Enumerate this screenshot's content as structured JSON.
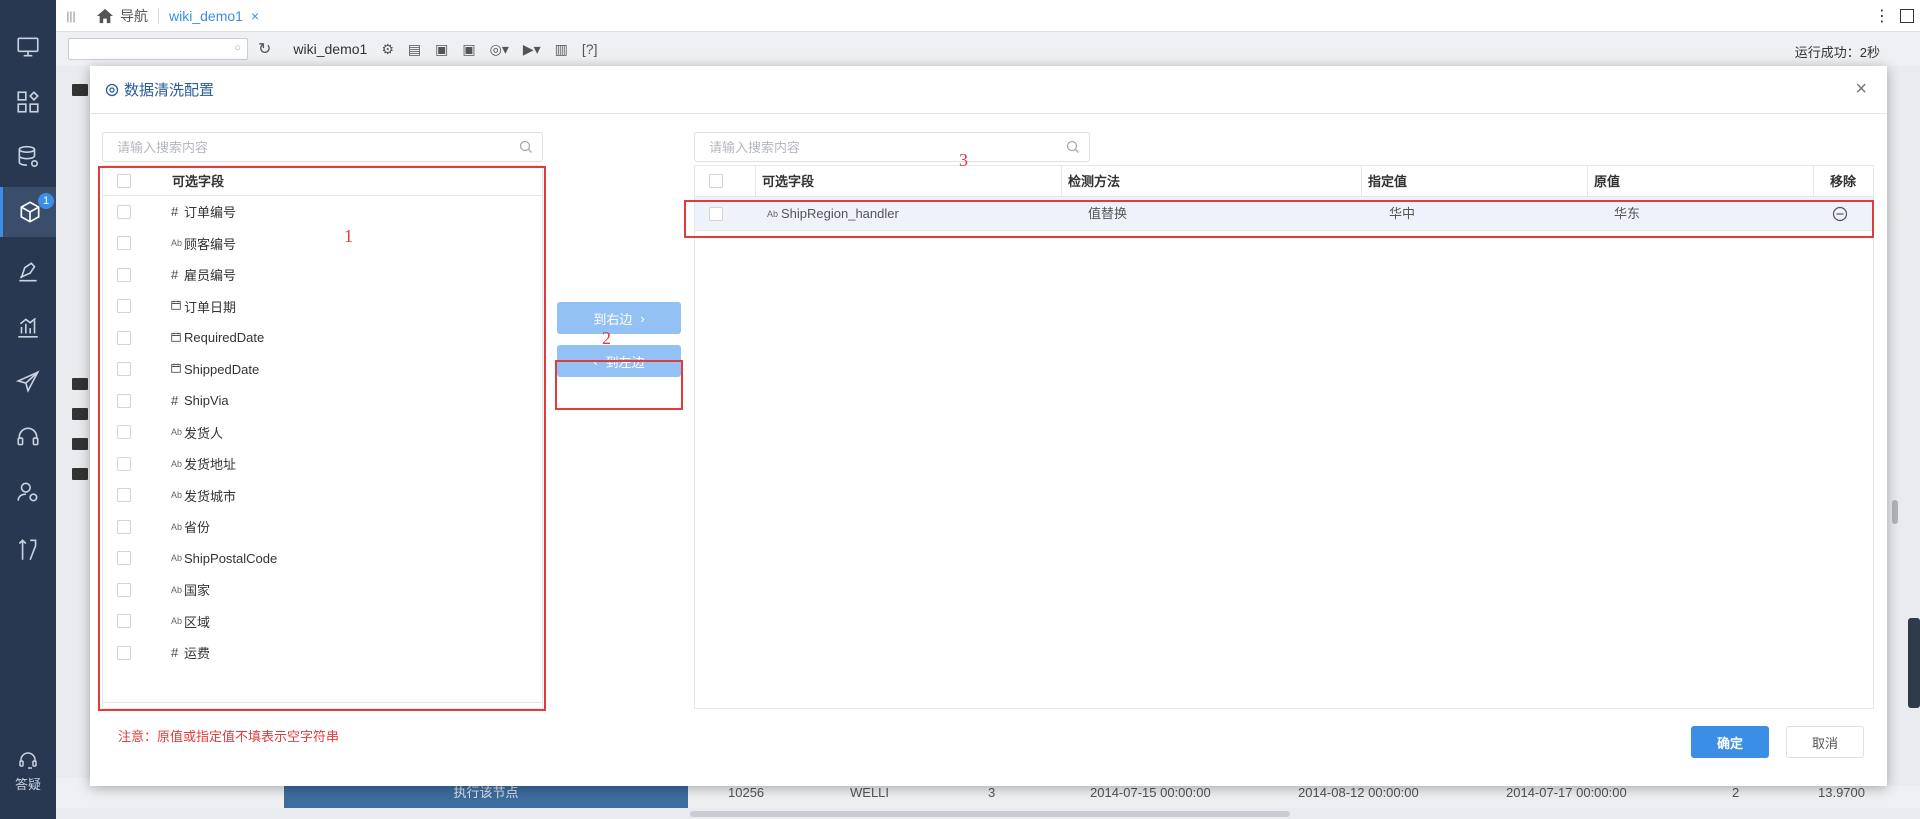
{
  "sidebar": {
    "items": [
      {
        "icon": "monitor-icon"
      },
      {
        "icon": "apps-icon"
      },
      {
        "icon": "database-settings-icon"
      },
      {
        "icon": "cube-icon",
        "badge": "1",
        "active": true
      },
      {
        "icon": "pen-tool-icon"
      },
      {
        "icon": "bar-chart-icon"
      },
      {
        "icon": "send-icon"
      },
      {
        "icon": "headset-icon"
      },
      {
        "icon": "user-settings-icon"
      },
      {
        "icon": "tools-icon"
      }
    ],
    "help_label": "答疑"
  },
  "tabbar": {
    "home_label": "导航",
    "tab_label": "wiki_demo1",
    "close_glyph": "×",
    "more_glyph": "⋮"
  },
  "toolbar": {
    "workflow_name": "wiki_demo1",
    "help_label": "[?]",
    "status": "运行成功：2秒"
  },
  "background_row": {
    "exec_label": "执行该节点",
    "cells": [
      "10256",
      "WELLI",
      "3",
      "2014-07-15 00:00:00",
      "2014-08-12 00:00:00",
      "2014-07-17 00:00:00",
      "2",
      "13.9700"
    ]
  },
  "modal": {
    "title": "数据清洗配置",
    "close_glyph": "×",
    "left": {
      "search_placeholder": "请输入搜索内容",
      "header": "可选字段",
      "fields": [
        {
          "type": "#",
          "name": "订单编号"
        },
        {
          "type": "Ab",
          "name": "顾客编号"
        },
        {
          "type": "#",
          "name": "雇员编号"
        },
        {
          "type": "date",
          "name": "订单日期"
        },
        {
          "type": "date",
          "name": "RequiredDate"
        },
        {
          "type": "date",
          "name": "ShippedDate"
        },
        {
          "type": "#",
          "name": "ShipVia"
        },
        {
          "type": "Ab",
          "name": "发货人"
        },
        {
          "type": "Ab",
          "name": "发货地址"
        },
        {
          "type": "Ab",
          "name": "发货城市"
        },
        {
          "type": "Ab",
          "name": "省份"
        },
        {
          "type": "Ab",
          "name": "ShipPostalCode"
        },
        {
          "type": "Ab",
          "name": "国家"
        },
        {
          "type": "Ab",
          "name": "区域"
        },
        {
          "type": "#",
          "name": "运费"
        }
      ]
    },
    "to_right_label": "到右边",
    "to_left_label": "到左边",
    "right": {
      "search_placeholder": "请输入搜索内容",
      "columns": [
        "可选字段",
        "检测方法",
        "指定值",
        "原值",
        "移除"
      ],
      "rows": [
        {
          "type": "Ab",
          "field": "ShipRegion_handler",
          "method": "值替换",
          "specified": "华中",
          "original": "华东"
        }
      ]
    },
    "annotations": [
      "1",
      "2",
      "3"
    ],
    "note": "注意：原值或指定值不填表示空字符串",
    "confirm_label": "确定",
    "cancel_label": "取消"
  },
  "colors": {
    "accent": "#3a8ee6",
    "sidebar_bg": "#283851",
    "annotation_red": "#e23b3b",
    "disabled_button": "#93c1f3"
  }
}
